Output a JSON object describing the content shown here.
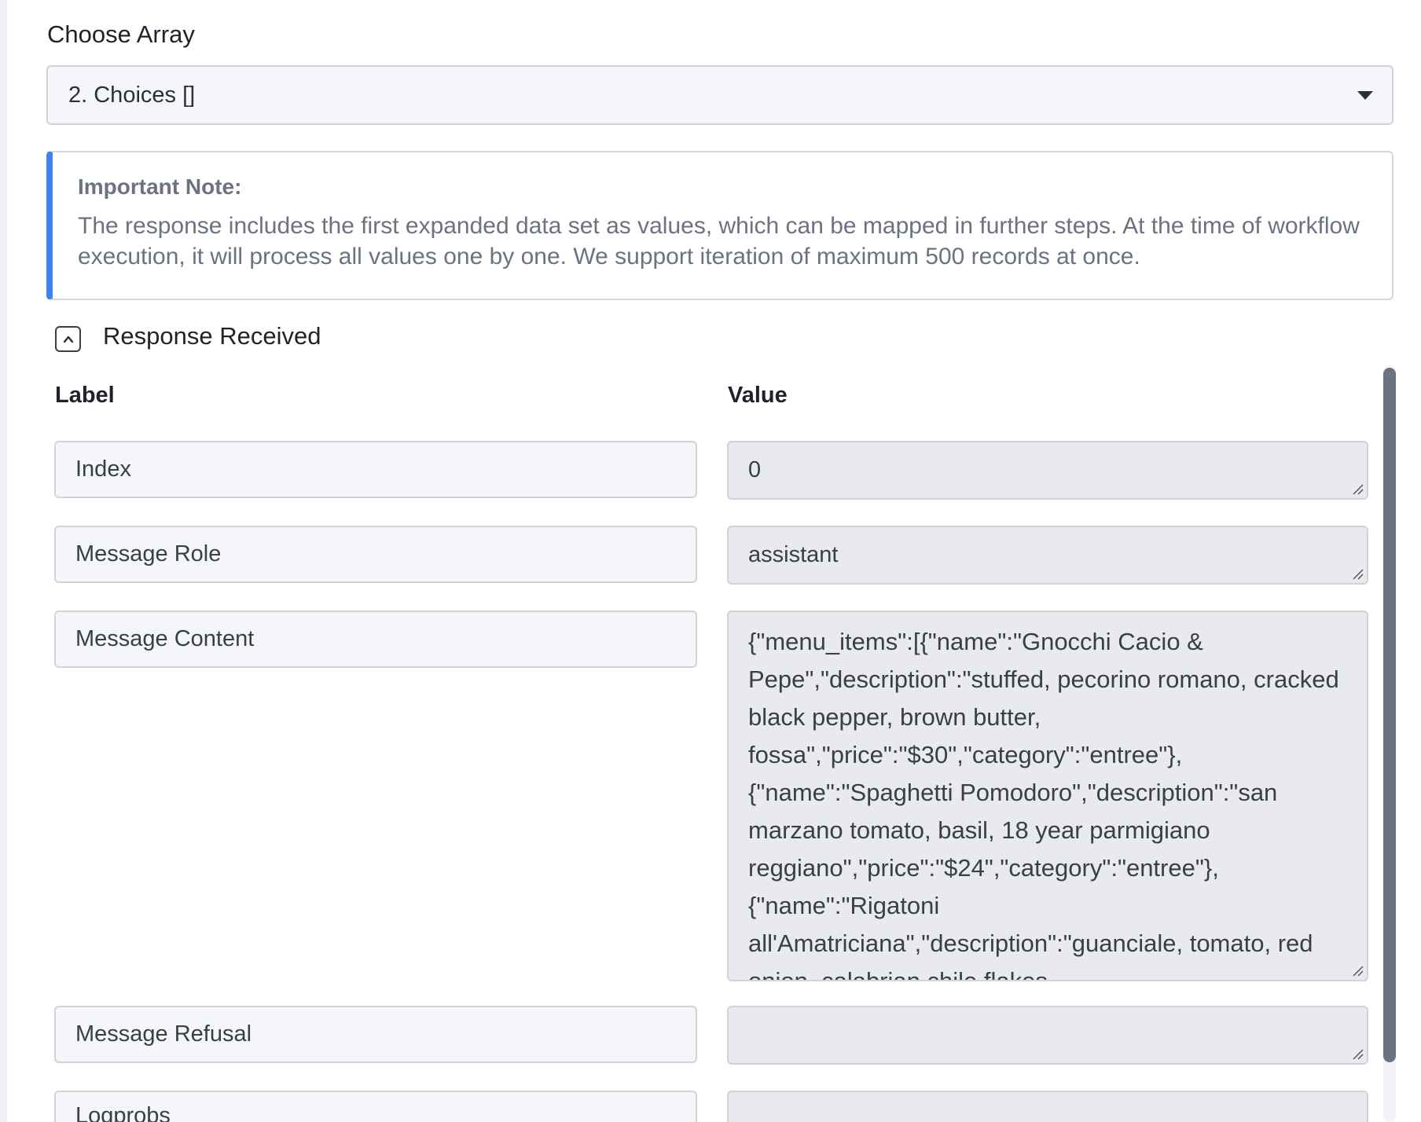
{
  "choose_array": {
    "label": "Choose Array",
    "selected": "2. Choices []"
  },
  "note": {
    "title": "Important Note:",
    "text": "The response includes the first expanded data set as values, which can be mapped in further steps. At the time of workflow execution, it will process all values one by one. We support iteration of maximum 500 records at once."
  },
  "response": {
    "title": "Response Received",
    "label_header": "Label",
    "value_header": "Value",
    "rows": [
      {
        "label": "Index",
        "value": "0"
      },
      {
        "label": "Message Role",
        "value": "assistant"
      },
      {
        "label": "Message Content",
        "value": "{\"menu_items\":[{\"name\":\"Gnocchi Cacio & Pepe\",\"description\":\"stuffed, pecorino romano, cracked black pepper, brown butter, fossa\",\"price\":\"$30\",\"category\":\"entree\"},{\"name\":\"Spaghetti Pomodoro\",\"description\":\"san marzano tomato, basil, 18 year parmigiano reggiano\",\"price\":\"$24\",\"category\":\"entree\"},{\"name\":\"Rigatoni all'Amatriciana\",\"description\":\"guanciale, tomato, red onion, calabrian chile flakes"
      },
      {
        "label": "Message Refusal",
        "value": ""
      },
      {
        "label": "Logprobs",
        "value": ""
      }
    ]
  },
  "colors": {
    "accent": "#3b82f6",
    "field_bg": "#f4f6f9",
    "value_bg": "#e9eaee",
    "border": "#cfd4dc",
    "scroll_thumb": "#6b7280"
  },
  "icons": {
    "select": "chevron-down-icon",
    "collapse": "chevron-up-icon",
    "resize": "resize-grip-icon"
  }
}
